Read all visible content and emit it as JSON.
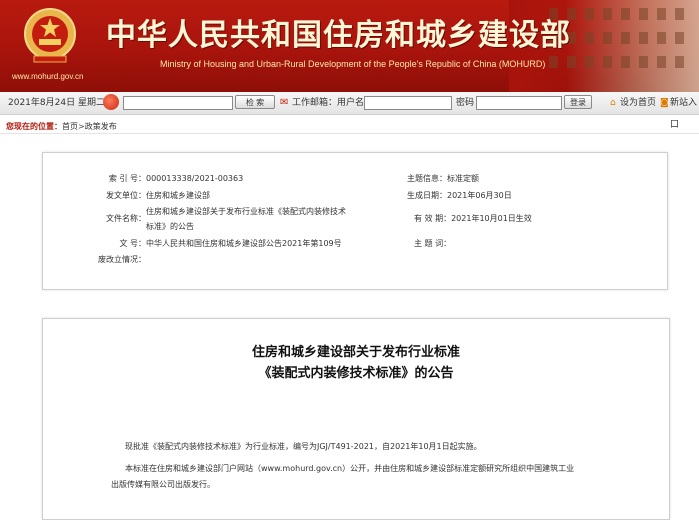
{
  "header": {
    "cn_title": "中华人民共和国住房和城乡建设部",
    "en_title": "Ministry of Housing and Urban-Rural Development of the People's Republic of China (MOHURD)",
    "site_url": "www.mohurd.gov.cn",
    "colors": {
      "banner": "#a8140c",
      "title": "#fff6d6"
    }
  },
  "toolbar": {
    "date": "2021年8月24日 星期二",
    "search_button": "检    索",
    "mail_label": "工作邮箱：用户名",
    "password_label": "密码",
    "login_button": "登录",
    "set_home": "设为首页",
    "rss": "新站入口"
  },
  "breadcrumb": {
    "location_label": "您现在的位置：",
    "home": "首页",
    "sep": ">",
    "current": "政策发布"
  },
  "meta": {
    "index_label": "索 引 号：",
    "index_value": "000013338/2021-00363",
    "category_label": "主题信息：",
    "category_value": "标准定额",
    "issuer_label": "发文单位：",
    "issuer_value": "住房和城乡建设部",
    "created_label": "生成日期：",
    "created_value": "2021年06月30日",
    "doc_name_label": "文件名称：",
    "doc_name_line1": "住房和城乡建设部关于发布行业标准《装配式内装修技术",
    "doc_name_line2": "标准》的公告",
    "effective_label": "有 效 期：",
    "effective_value": "2021年10月01日生效",
    "docno_label": "文       号：",
    "docno_value": "中华人民共和国住房和城乡建设部公告2021年第109号",
    "keywords_label": "主 题 词：",
    "keywords_value": "",
    "repeal_label": "废改立情况：",
    "repeal_value": ""
  },
  "article": {
    "title_line1": "住房和城乡建设部关于发布行业标准",
    "title_line2": "《装配式内装修技术标准》的公告",
    "p1": "现批准《装配式内装修技术标准》为行业标准，编号为JGJ/T491-2021，自2021年10月1日起实施。",
    "p2_line1": "本标准在住房和城乡建设部门户网站（www.mohurd.gov.cn）公开，并由住房和城乡建设部标准定额研究所组织中国建筑工业",
    "p2_line2": "出版传媒有限公司出版发行。"
  }
}
